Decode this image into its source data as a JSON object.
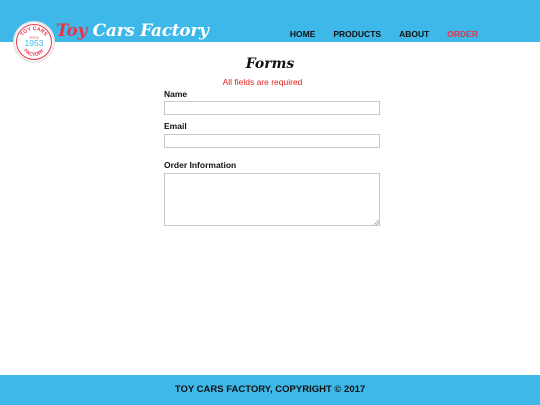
{
  "brand": {
    "name_part1": "Toy",
    "name_part2": " Cars Factory",
    "logo": {
      "top_text": "TOY CARS",
      "since": "SINCE",
      "year": "1953",
      "bottom_text": "FACTORY"
    }
  },
  "nav": {
    "items": [
      {
        "label": "HOME",
        "active": false
      },
      {
        "label": "PRODUCTS",
        "active": false
      },
      {
        "label": "ABOUT",
        "active": false
      },
      {
        "label": "ORDER",
        "active": true
      }
    ]
  },
  "form": {
    "title": "Forms",
    "required_note": "All fields are required",
    "name_label": "Name",
    "name_value": "",
    "email_label": "Email",
    "email_value": "",
    "order_label": "Order Information",
    "order_value": ""
  },
  "footer": {
    "text": "TOY CARS FACTORY, COPYRIGHT © 2017"
  },
  "colors": {
    "header_bg": "#3db8e8",
    "accent": "#e8334a",
    "required": "#e02020"
  }
}
